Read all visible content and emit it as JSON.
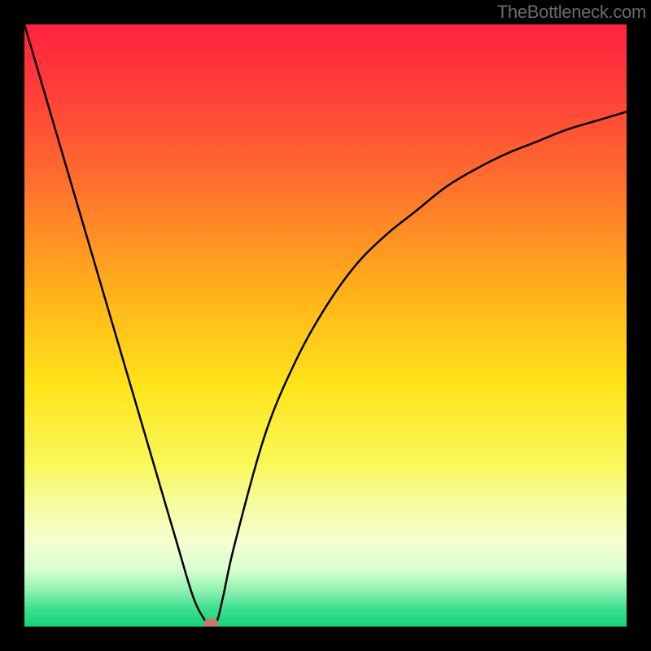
{
  "watermark": "TheBottleneck.com",
  "chart_data": {
    "type": "line",
    "title": "",
    "xlabel": "",
    "ylabel": "",
    "xlim": [
      0,
      100
    ],
    "ylim": [
      0,
      100
    ],
    "x": [
      0,
      5,
      10,
      15,
      20,
      25,
      28,
      30,
      31,
      32,
      33,
      35,
      40,
      45,
      50,
      55,
      60,
      65,
      70,
      75,
      80,
      85,
      90,
      95,
      100
    ],
    "values": [
      100,
      83,
      66,
      49,
      32,
      15,
      5,
      1,
      0,
      1,
      5,
      14,
      32,
      44,
      53,
      60,
      65,
      69,
      73,
      76,
      78.5,
      80.5,
      82.5,
      84,
      85.5
    ],
    "marker": {
      "x": 31,
      "y": 0.5,
      "color": "#c77a6a"
    },
    "background_gradient": {
      "stops": [
        {
          "offset": 0.0,
          "color": "#ff223f"
        },
        {
          "offset": 0.1,
          "color": "#ff3b3a"
        },
        {
          "offset": 0.25,
          "color": "#ff6b2f"
        },
        {
          "offset": 0.45,
          "color": "#ffb31a"
        },
        {
          "offset": 0.6,
          "color": "#ffe41a"
        },
        {
          "offset": 0.73,
          "color": "#f8f85a"
        },
        {
          "offset": 0.8,
          "color": "#f5fca2"
        },
        {
          "offset": 0.86,
          "color": "#f5ffd0"
        },
        {
          "offset": 0.905,
          "color": "#d9ffd0"
        },
        {
          "offset": 0.94,
          "color": "#8ef2b0"
        },
        {
          "offset": 0.97,
          "color": "#3de090"
        },
        {
          "offset": 1.0,
          "color": "#14d47a"
        }
      ]
    },
    "frame_color": "#000000",
    "line_color": "#000000"
  }
}
